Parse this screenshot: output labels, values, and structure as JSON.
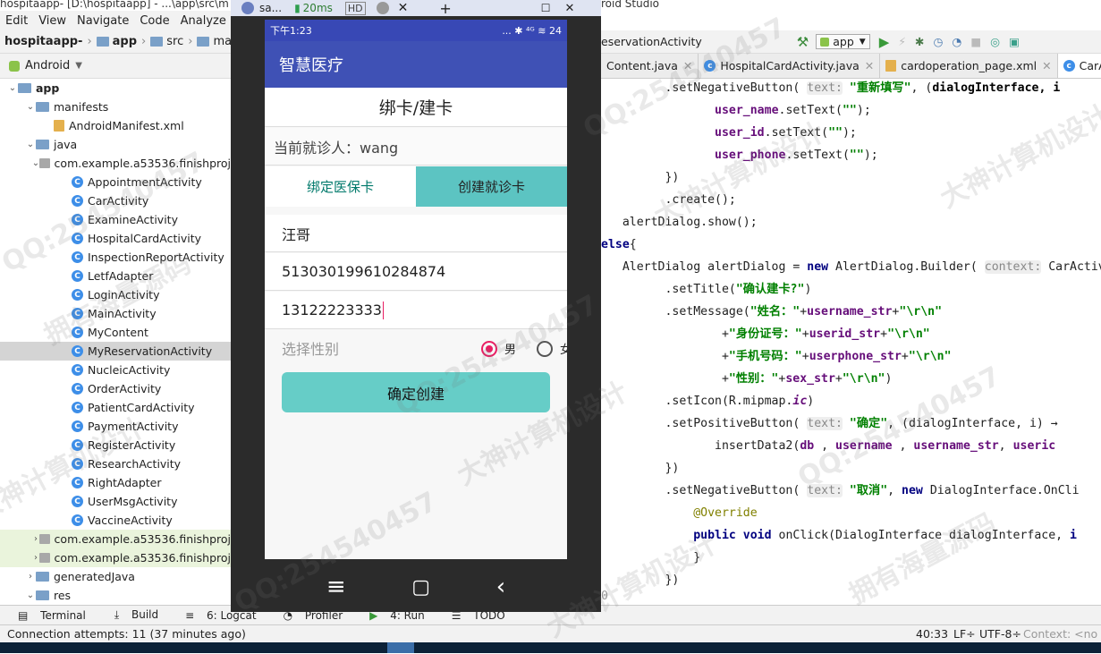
{
  "ide": {
    "title_left": "hospitaapp- [D:\\hospitaapp] - ...\\app\\src\\m",
    "title_right": "roid Studio",
    "menu": [
      "Edit",
      "View",
      "Navigate",
      "Code",
      "Analyze"
    ],
    "breadcrumb": [
      "hospitaapp-",
      "app",
      "src",
      "main"
    ],
    "project_view": "Android",
    "tree": [
      {
        "label": "app",
        "type": "module",
        "level": 0,
        "arrow": "v"
      },
      {
        "label": "manifests",
        "type": "folder",
        "level": 1,
        "arrow": "v"
      },
      {
        "label": "AndroidManifest.xml",
        "type": "xml",
        "level": 2,
        "arrow": ""
      },
      {
        "label": "java",
        "type": "folder",
        "level": 1,
        "arrow": "v"
      },
      {
        "label": "com.example.a53536.finishproj",
        "type": "package",
        "level": 2,
        "arrow": "v"
      },
      {
        "label": "AppointmentActivity",
        "type": "class",
        "level": 3,
        "arrow": ""
      },
      {
        "label": "CarActivity",
        "type": "class",
        "level": 3,
        "arrow": ""
      },
      {
        "label": "ExamineActivity",
        "type": "class",
        "level": 3,
        "arrow": ""
      },
      {
        "label": "HospitalCardActivity",
        "type": "class",
        "level": 3,
        "arrow": ""
      },
      {
        "label": "InspectionReportActivity",
        "type": "class",
        "level": 3,
        "arrow": ""
      },
      {
        "label": "LetfAdapter",
        "type": "class",
        "level": 3,
        "arrow": ""
      },
      {
        "label": "LoginActivity",
        "type": "class",
        "level": 3,
        "arrow": ""
      },
      {
        "label": "MainActivity",
        "type": "class",
        "level": 3,
        "arrow": ""
      },
      {
        "label": "MyContent",
        "type": "class",
        "level": 3,
        "arrow": ""
      },
      {
        "label": "MyReservationActivity",
        "type": "class",
        "level": 3,
        "arrow": "",
        "selected": true
      },
      {
        "label": "NucleicActivity",
        "type": "class",
        "level": 3,
        "arrow": ""
      },
      {
        "label": "OrderActivity",
        "type": "class",
        "level": 3,
        "arrow": ""
      },
      {
        "label": "PatientCardActivity",
        "type": "class",
        "level": 3,
        "arrow": ""
      },
      {
        "label": "PaymentActivity",
        "type": "class",
        "level": 3,
        "arrow": ""
      },
      {
        "label": "RegisterActivity",
        "type": "class",
        "level": 3,
        "arrow": ""
      },
      {
        "label": "ResearchActivity",
        "type": "class",
        "level": 3,
        "arrow": ""
      },
      {
        "label": "RightAdapter",
        "type": "class",
        "level": 3,
        "arrow": ""
      },
      {
        "label": "UserMsgActivity",
        "type": "class",
        "level": 3,
        "arrow": ""
      },
      {
        "label": "VaccineActivity",
        "type": "class",
        "level": 3,
        "arrow": ""
      },
      {
        "label": "com.example.a53536.finishproj",
        "type": "package",
        "level": 2,
        "arrow": ">",
        "highlight": true
      },
      {
        "label": "com.example.a53536.finishproj",
        "type": "package",
        "level": 2,
        "arrow": ">",
        "highlight": true
      },
      {
        "label": "generatedJava",
        "type": "folder",
        "level": 1,
        "arrow": ">"
      },
      {
        "label": "res",
        "type": "folder",
        "level": 1,
        "arrow": "v"
      }
    ],
    "run_config": "app",
    "tool_tab_prefix": "eservationActivity",
    "file_tabs": [
      {
        "label": "Content.java",
        "active": false
      },
      {
        "label": "HospitalCardActivity.java",
        "active": false
      },
      {
        "label": "cardoperation_page.xml",
        "active": false
      },
      {
        "label": "CarActivity.j",
        "active": true
      }
    ],
    "tool_windows": [
      "Terminal",
      "Build",
      "6: Logcat",
      "Profiler",
      "4: Run",
      "TODO"
    ],
    "status_left": "Connection attempts: 11 (37 minutes ago)",
    "status_pos": "40:33",
    "status_lf": "LF÷",
    "status_enc": "UTF-8÷",
    "status_ctx": "Context: <no co",
    "gutter_num": "0"
  },
  "emulator": {
    "window_title": "sa...",
    "signal": "20ms",
    "phone": {
      "time": "下午1:23",
      "status_icons": "... ✱ ⁴ᴳ ≋ 24",
      "app_title": "智慧医疗",
      "page_title": "绑卡/建卡",
      "current_patient": "当前就诊人：wang",
      "tab_bind": "绑定医保卡",
      "tab_create": "创建就诊卡",
      "name_value": "汪哥",
      "id_value": "513030199610284874",
      "phone_value": "13122223333",
      "gender_placeholder": "选择性别",
      "gender_male": "男",
      "gender_female": "女",
      "gender_selected": "male",
      "submit_label": "确定创建"
    }
  },
  "watermark": {
    "qq": "QQ:254540457",
    "t1": "大神计算机设计",
    "t2": "拥有海量源码"
  }
}
